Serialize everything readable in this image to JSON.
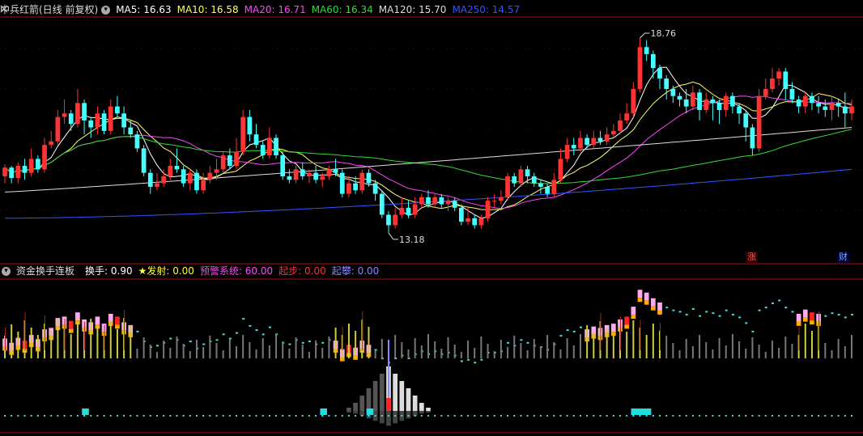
{
  "header": {
    "title": "中兵红箭(日线 前复权)",
    "ma": [
      {
        "label": "MA5: 16.63",
        "color": "#ffffff"
      },
      {
        "label": "MA10: 16.58",
        "color": "#ffff66"
      },
      {
        "label": "MA20: 16.71",
        "color": "#ff44ff"
      },
      {
        "label": "MA60: 16.34",
        "color": "#33dd33"
      },
      {
        "label": "MA120: 15.70",
        "color": "#dddddd"
      },
      {
        "label": "MA250: 14.57",
        "color": "#3355ff"
      }
    ]
  },
  "indicator": {
    "name": "资金换手连板",
    "items": [
      {
        "label": "换手: 0.90",
        "color": "#ffffff"
      },
      {
        "label": "★发射: 0.00",
        "color": "#ffff33"
      },
      {
        "label": "预警系统: 60.00",
        "color": "#ff44ff"
      },
      {
        "label": "起步: 0.00",
        "color": "#ff3333"
      },
      {
        "label": "起攀: 0.00",
        "color": "#8888ff"
      }
    ]
  },
  "markers": {
    "high": "18.76",
    "low": "13.18"
  },
  "badges": [
    {
      "text": "涨",
      "color": "#ff4444"
    },
    {
      "text": "财",
      "color": "#66aaff"
    }
  ],
  "close_icon": "close-icon",
  "colors": {
    "up": "#ff3333",
    "down": "#44ffff",
    "border": "#aa1111",
    "dotted": "#44dddd"
  },
  "chart_data": {
    "type": "candlestick",
    "title": "中兵红箭(日线 前复权)",
    "high_marker": 18.76,
    "low_marker": 13.18,
    "ylim": [
      12.9,
      19.2
    ],
    "candles": [
      [
        14.8,
        15.05,
        15.15,
        14.6
      ],
      [
        15.05,
        14.75,
        15.1,
        14.6
      ],
      [
        14.75,
        15.1,
        15.2,
        14.6
      ],
      [
        15.1,
        14.9,
        15.3,
        14.7
      ],
      [
        14.9,
        15.3,
        15.6,
        14.8
      ],
      [
        15.3,
        15.0,
        15.4,
        14.9
      ],
      [
        15.0,
        15.7,
        15.9,
        14.9
      ],
      [
        15.7,
        15.8,
        16.1,
        15.6
      ],
      [
        15.8,
        16.5,
        16.7,
        15.7
      ],
      [
        16.5,
        16.6,
        17.0,
        16.3
      ],
      [
        16.6,
        16.3,
        16.7,
        16.1
      ],
      [
        16.3,
        16.9,
        17.3,
        16.2
      ],
      [
        16.9,
        16.4,
        17.0,
        16.0
      ],
      [
        16.4,
        16.2,
        16.5,
        15.9
      ],
      [
        16.2,
        16.6,
        16.8,
        16.0
      ],
      [
        16.6,
        16.1,
        16.7,
        16.0
      ],
      [
        16.1,
        16.8,
        17.0,
        16.0
      ],
      [
        16.8,
        16.6,
        17.1,
        16.5
      ],
      [
        16.6,
        16.2,
        16.8,
        16.0
      ],
      [
        16.2,
        16.0,
        16.4,
        15.9
      ],
      [
        16.0,
        15.6,
        16.1,
        15.5
      ],
      [
        15.6,
        14.9,
        15.7,
        14.8
      ],
      [
        14.9,
        14.5,
        15.0,
        14.3
      ],
      [
        14.5,
        14.6,
        14.9,
        14.4
      ],
      [
        14.6,
        14.8,
        15.0,
        14.5
      ],
      [
        14.8,
        15.1,
        15.3,
        14.7
      ],
      [
        15.1,
        15.0,
        15.6,
        14.9
      ],
      [
        15.0,
        14.6,
        15.1,
        14.5
      ],
      [
        14.6,
        14.9,
        15.0,
        14.4
      ],
      [
        14.9,
        14.4,
        15.0,
        14.3
      ],
      [
        14.4,
        14.7,
        14.9,
        14.3
      ],
      [
        14.7,
        14.9,
        15.1,
        14.6
      ],
      [
        14.9,
        15.0,
        15.3,
        14.7
      ],
      [
        15.0,
        15.4,
        15.5,
        14.9
      ],
      [
        15.4,
        15.1,
        15.6,
        15.0
      ],
      [
        15.1,
        15.5,
        15.9,
        15.0
      ],
      [
        15.5,
        16.5,
        16.7,
        15.4
      ],
      [
        16.5,
        16.0,
        16.7,
        15.8
      ],
      [
        16.0,
        15.7,
        16.3,
        15.6
      ],
      [
        15.7,
        15.4,
        15.8,
        15.3
      ],
      [
        15.4,
        15.9,
        16.2,
        15.3
      ],
      [
        15.9,
        15.4,
        16.0,
        15.3
      ],
      [
        15.4,
        14.8,
        15.5,
        14.7
      ],
      [
        14.8,
        14.7,
        15.0,
        14.6
      ],
      [
        14.7,
        15.0,
        15.1,
        14.6
      ],
      [
        15.0,
        14.8,
        15.2,
        14.7
      ],
      [
        14.8,
        14.9,
        15.0,
        14.6
      ],
      [
        14.9,
        14.7,
        15.1,
        14.6
      ],
      [
        14.7,
        14.8,
        14.9,
        14.5
      ],
      [
        14.8,
        15.0,
        15.1,
        14.7
      ],
      [
        15.0,
        14.9,
        15.3,
        14.8
      ],
      [
        14.9,
        14.3,
        15.0,
        14.2
      ],
      [
        14.3,
        14.6,
        14.8,
        14.2
      ],
      [
        14.6,
        14.4,
        14.8,
        14.3
      ],
      [
        14.4,
        14.9,
        15.0,
        14.3
      ],
      [
        14.9,
        14.6,
        15.0,
        14.5
      ],
      [
        14.6,
        14.3,
        14.7,
        14.1
      ],
      [
        14.3,
        13.7,
        14.4,
        13.6
      ],
      [
        13.7,
        13.4,
        13.8,
        13.18
      ],
      [
        13.4,
        13.7,
        13.9,
        13.3
      ],
      [
        13.7,
        13.9,
        14.2,
        13.6
      ],
      [
        13.9,
        13.7,
        14.1,
        13.6
      ],
      [
        13.7,
        14.0,
        14.2,
        13.6
      ],
      [
        14.0,
        14.2,
        14.3,
        13.9
      ],
      [
        14.2,
        14.0,
        14.4,
        13.9
      ],
      [
        14.0,
        14.2,
        14.3,
        13.9
      ],
      [
        14.2,
        14.0,
        14.3,
        13.9
      ],
      [
        14.0,
        14.1,
        14.2,
        13.8
      ],
      [
        14.1,
        13.9,
        14.2,
        13.8
      ],
      [
        13.9,
        13.5,
        14.0,
        13.4
      ],
      [
        13.5,
        13.6,
        13.9,
        13.4
      ],
      [
        13.6,
        13.4,
        13.7,
        13.3
      ],
      [
        13.4,
        13.6,
        13.7,
        13.3
      ],
      [
        13.6,
        14.1,
        14.2,
        13.5
      ],
      [
        14.1,
        14.1,
        14.3,
        13.9
      ],
      [
        14.1,
        14.2,
        14.4,
        14.0
      ],
      [
        14.2,
        14.8,
        14.9,
        14.1
      ],
      [
        14.8,
        14.6,
        14.9,
        14.5
      ],
      [
        14.6,
        15.0,
        15.1,
        14.5
      ],
      [
        15.0,
        14.8,
        15.1,
        14.6
      ],
      [
        14.8,
        14.6,
        14.9,
        14.5
      ],
      [
        14.6,
        14.5,
        14.7,
        14.3
      ],
      [
        14.5,
        14.3,
        14.6,
        14.2
      ],
      [
        14.3,
        14.7,
        14.9,
        14.2
      ],
      [
        14.7,
        15.3,
        15.6,
        14.6
      ],
      [
        15.3,
        15.7,
        15.9,
        15.2
      ],
      [
        15.7,
        15.6,
        15.9,
        15.4
      ],
      [
        15.6,
        15.9,
        16.1,
        15.5
      ],
      [
        15.9,
        15.7,
        16.0,
        15.6
      ],
      [
        15.7,
        15.9,
        16.1,
        15.6
      ],
      [
        15.9,
        15.8,
        16.1,
        15.7
      ],
      [
        15.8,
        16.0,
        16.2,
        15.7
      ],
      [
        16.0,
        16.1,
        16.3,
        15.9
      ],
      [
        16.1,
        16.4,
        16.6,
        16.0
      ],
      [
        16.4,
        16.6,
        16.9,
        16.3
      ],
      [
        16.6,
        17.3,
        17.5,
        16.5
      ],
      [
        17.3,
        18.5,
        18.76,
        17.2
      ],
      [
        18.5,
        18.3,
        18.7,
        18.1
      ],
      [
        18.3,
        17.9,
        18.4,
        17.6
      ],
      [
        17.9,
        17.6,
        18.0,
        17.3
      ],
      [
        17.6,
        17.3,
        17.7,
        17.0
      ],
      [
        17.3,
        17.1,
        17.4,
        16.9
      ],
      [
        17.1,
        17.0,
        17.2,
        16.8
      ],
      [
        17.0,
        16.8,
        17.3,
        16.6
      ],
      [
        16.8,
        17.2,
        17.4,
        16.7
      ],
      [
        17.2,
        16.7,
        17.3,
        16.4
      ],
      [
        16.7,
        17.0,
        17.2,
        16.6
      ],
      [
        17.0,
        16.9,
        17.1,
        16.4
      ],
      [
        16.9,
        16.7,
        17.0,
        16.3
      ],
      [
        16.7,
        17.1,
        17.2,
        16.5
      ],
      [
        17.1,
        16.8,
        17.2,
        16.6
      ],
      [
        16.8,
        16.6,
        16.9,
        16.3
      ],
      [
        16.6,
        16.2,
        16.7,
        15.8
      ],
      [
        16.2,
        15.6,
        16.3,
        15.4
      ],
      [
        15.6,
        17.1,
        17.3,
        15.5
      ],
      [
        17.1,
        17.3,
        17.6,
        17.0
      ],
      [
        17.3,
        17.6,
        17.9,
        17.2
      ],
      [
        17.6,
        17.8,
        17.9,
        17.4
      ],
      [
        17.8,
        17.3,
        17.9,
        17.0
      ],
      [
        17.3,
        17.0,
        17.5,
        16.9
      ],
      [
        17.0,
        16.8,
        17.1,
        16.6
      ],
      [
        16.8,
        17.1,
        17.2,
        16.6
      ],
      [
        17.1,
        16.9,
        17.2,
        16.7
      ],
      [
        16.9,
        16.8,
        17.1,
        16.6
      ],
      [
        16.8,
        16.7,
        17.0,
        16.5
      ],
      [
        16.7,
        16.9,
        17.1,
        16.4
      ],
      [
        16.9,
        16.8,
        17.0,
        16.5
      ],
      [
        16.8,
        16.6,
        17.2,
        16.2
      ],
      [
        16.6,
        16.8,
        17.0,
        16.4
      ]
    ]
  }
}
